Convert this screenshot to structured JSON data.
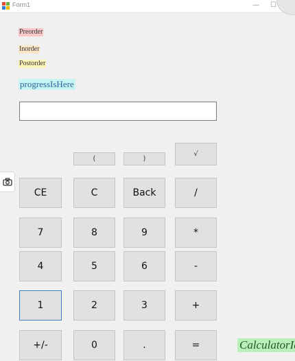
{
  "window": {
    "title": "Form1",
    "minimize_glyph": "—",
    "maximize_glyph": "☐",
    "close_glyph": "✕"
  },
  "labels": {
    "preorder": "Preorder",
    "inorder": "Inorder",
    "postorder": "Postorder",
    "progress": "progressIsHere",
    "calculator_id": "CalculatorId"
  },
  "colors": {
    "preorder_bg": "#f8c8c8",
    "inorder_bg": "#fde5c8",
    "postorder_bg": "#fdf4b8",
    "progress_bg": "#c8f4f4",
    "calculator_id_bg": "#b9f0b9"
  },
  "display": {
    "value": ""
  },
  "buttons": {
    "open_paren": "(",
    "close_paren": ")",
    "sqrt": "√",
    "ce": "CE",
    "c": "C",
    "back": "Back",
    "divide": "/",
    "seven": "7",
    "eight": "8",
    "nine": "9",
    "multiply": "*",
    "four": "4",
    "five": "5",
    "six": "6",
    "minus": "-",
    "one": "1",
    "two": "2",
    "three": "3",
    "plus": "+",
    "negate": "+/-",
    "zero": "0",
    "decimal": ".",
    "equals": "="
  },
  "icons": {
    "app": "winforms-app-icon",
    "camera": "camera-icon"
  }
}
